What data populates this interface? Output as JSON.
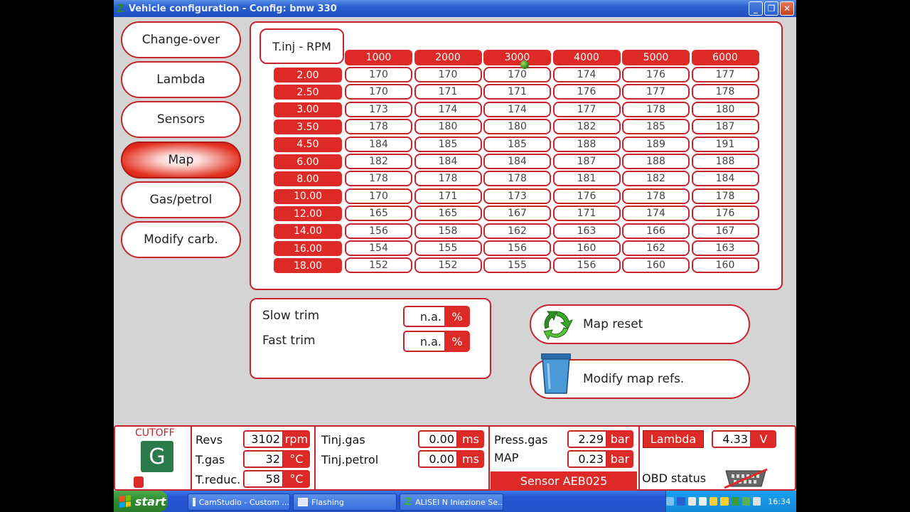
{
  "window": {
    "title": "Vehicle configuration - Config: bmw 330",
    "logo": "Z"
  },
  "nav": [
    "Change-over",
    "Lambda",
    "Sensors",
    "Map",
    "Gas/petrol",
    "Modify carb."
  ],
  "nav_active": 3,
  "map": {
    "corner_label": "T.inj - RPM",
    "columns": [
      "1000",
      "2000",
      "3000",
      "4000",
      "5000",
      "6000"
    ],
    "rows": [
      {
        "label": "2.00",
        "values": [
          "170",
          "170",
          "170",
          "174",
          "176",
          "177"
        ]
      },
      {
        "label": "2.50",
        "values": [
          "170",
          "171",
          "171",
          "176",
          "177",
          "178"
        ]
      },
      {
        "label": "3.00",
        "values": [
          "173",
          "174",
          "174",
          "177",
          "178",
          "180"
        ]
      },
      {
        "label": "3.50",
        "values": [
          "178",
          "180",
          "180",
          "182",
          "185",
          "187"
        ]
      },
      {
        "label": "4.50",
        "values": [
          "184",
          "185",
          "185",
          "188",
          "189",
          "191"
        ]
      },
      {
        "label": "6.00",
        "values": [
          "182",
          "184",
          "184",
          "187",
          "188",
          "188"
        ]
      },
      {
        "label": "8.00",
        "values": [
          "178",
          "178",
          "178",
          "181",
          "182",
          "184"
        ]
      },
      {
        "label": "10.00",
        "values": [
          "170",
          "171",
          "173",
          "176",
          "178",
          "178"
        ]
      },
      {
        "label": "12.00",
        "values": [
          "165",
          "165",
          "167",
          "171",
          "174",
          "176"
        ]
      },
      {
        "label": "14.00",
        "values": [
          "156",
          "158",
          "162",
          "163",
          "166",
          "167"
        ]
      },
      {
        "label": "16.00",
        "values": [
          "154",
          "155",
          "156",
          "160",
          "162",
          "163"
        ]
      },
      {
        "label": "18.00",
        "values": [
          "152",
          "152",
          "155",
          "156",
          "160",
          "160"
        ]
      }
    ]
  },
  "trim": {
    "slow_label": "Slow trim",
    "slow_value": "n.a.",
    "slow_unit": "%",
    "fast_label": "Fast trim",
    "fast_value": "n.a.",
    "fast_unit": "%"
  },
  "actions": {
    "map_reset": "Map reset",
    "modify_refs": "Modify map refs."
  },
  "status": {
    "cutoff": "CUTOFF",
    "cutoff_letter": "G",
    "revs_label": "Revs",
    "revs_value": "3102",
    "revs_unit": "rpm",
    "tgas_label": "T.gas",
    "tgas_value": "32",
    "tgas_unit": "°C",
    "treduc_label": "T.reduc.",
    "treduc_value": "58",
    "treduc_unit": "°C",
    "tinj_gas_label": "Tinj.gas",
    "tinj_gas_value": "0.00",
    "tinj_gas_unit": "ms",
    "tinj_petrol_label": "Tinj.petrol",
    "tinj_petrol_value": "0.00",
    "tinj_petrol_unit": "ms",
    "press_gas_label": "Press.gas",
    "press_gas_value": "2.29",
    "press_gas_unit": "bar",
    "map_label": "MAP",
    "map_value": "0.23",
    "map_unit": "bar",
    "sensor": "Sensor AEB025",
    "lambda_label": "Lambda",
    "lambda_value": "4.33",
    "lambda_unit": "V",
    "obd_label": "OBD status"
  },
  "taskbar": {
    "start": "start",
    "tasks": [
      "CamStudio - Custom ...",
      "Flashing",
      "ALISEI N Iniezione Se..."
    ],
    "clock": "16:34"
  },
  "colors": {
    "accent": "#de2a26",
    "border": "#c8232c",
    "cutoff_green": "#2a7a4a"
  }
}
